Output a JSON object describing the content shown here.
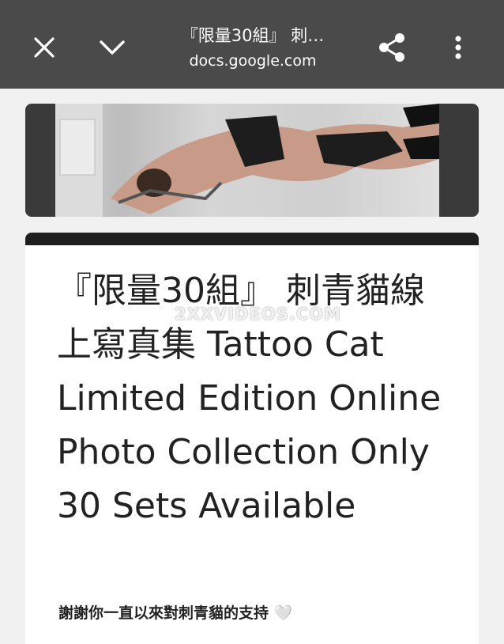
{
  "header": {
    "title": "『限量30組』 刺…",
    "url": "docs.google.com",
    "icons": {
      "close": "close-icon",
      "collapse": "chevron-down-icon",
      "share": "share-icon",
      "more": "more-vert-icon"
    }
  },
  "document": {
    "title": "『限量30組』 刺青貓線上寫真集 Tattoo Cat Limited Edition Online Photo Collection Only 30 Sets Available",
    "subtitle": "謝謝你一直以來對刺青貓的支持 🤍"
  },
  "watermark": "2XXVIDEOS.COM",
  "colors": {
    "toolbar": "#4a4a4a",
    "background": "#f1f1f1",
    "accent_bar": "#1f1f1f"
  }
}
